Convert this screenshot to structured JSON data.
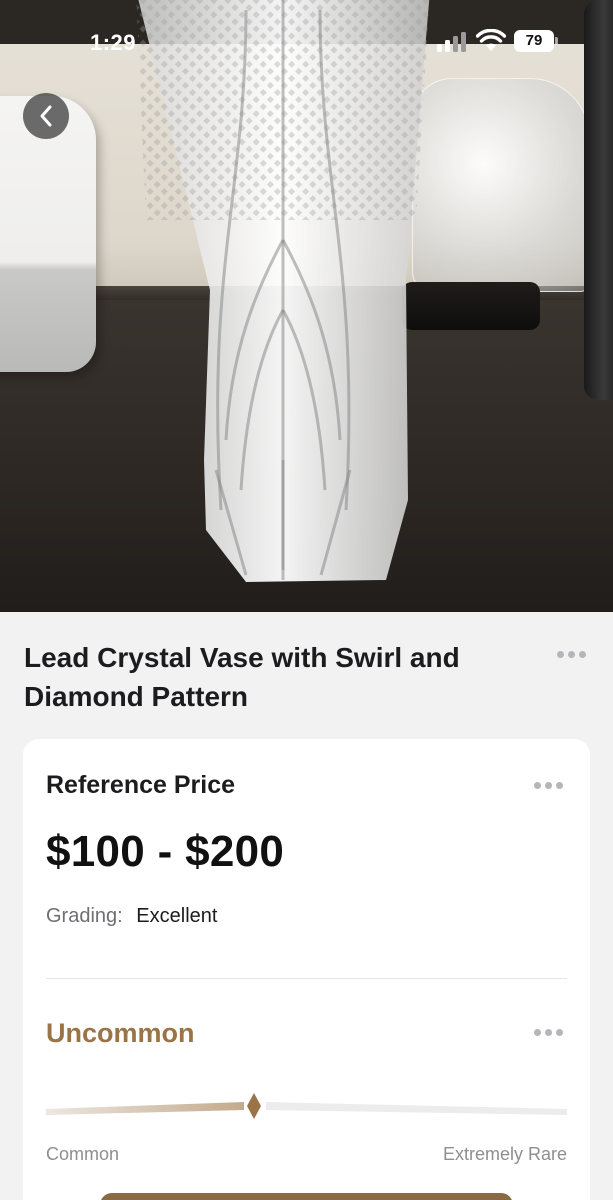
{
  "status_bar": {
    "time": "1:29",
    "battery": "79"
  },
  "item": {
    "title": "Lead Crystal Vase with Swirl and Diamond Pattern"
  },
  "price_card": {
    "label": "Reference Price",
    "price": "$100 - $200",
    "grading_label": "Grading:",
    "grading_value": "Excellent"
  },
  "rarity": {
    "label": "Uncommon",
    "scale_min_label": "Common",
    "scale_max_label": "Extremely Rare",
    "level_fraction": 0.4,
    "accent_color": "#9a7447"
  },
  "icons": [
    "back-chevron-icon",
    "more-dots-icon",
    "signal-icon",
    "wifi-icon",
    "battery-icon",
    "diamond-marker-icon"
  ]
}
